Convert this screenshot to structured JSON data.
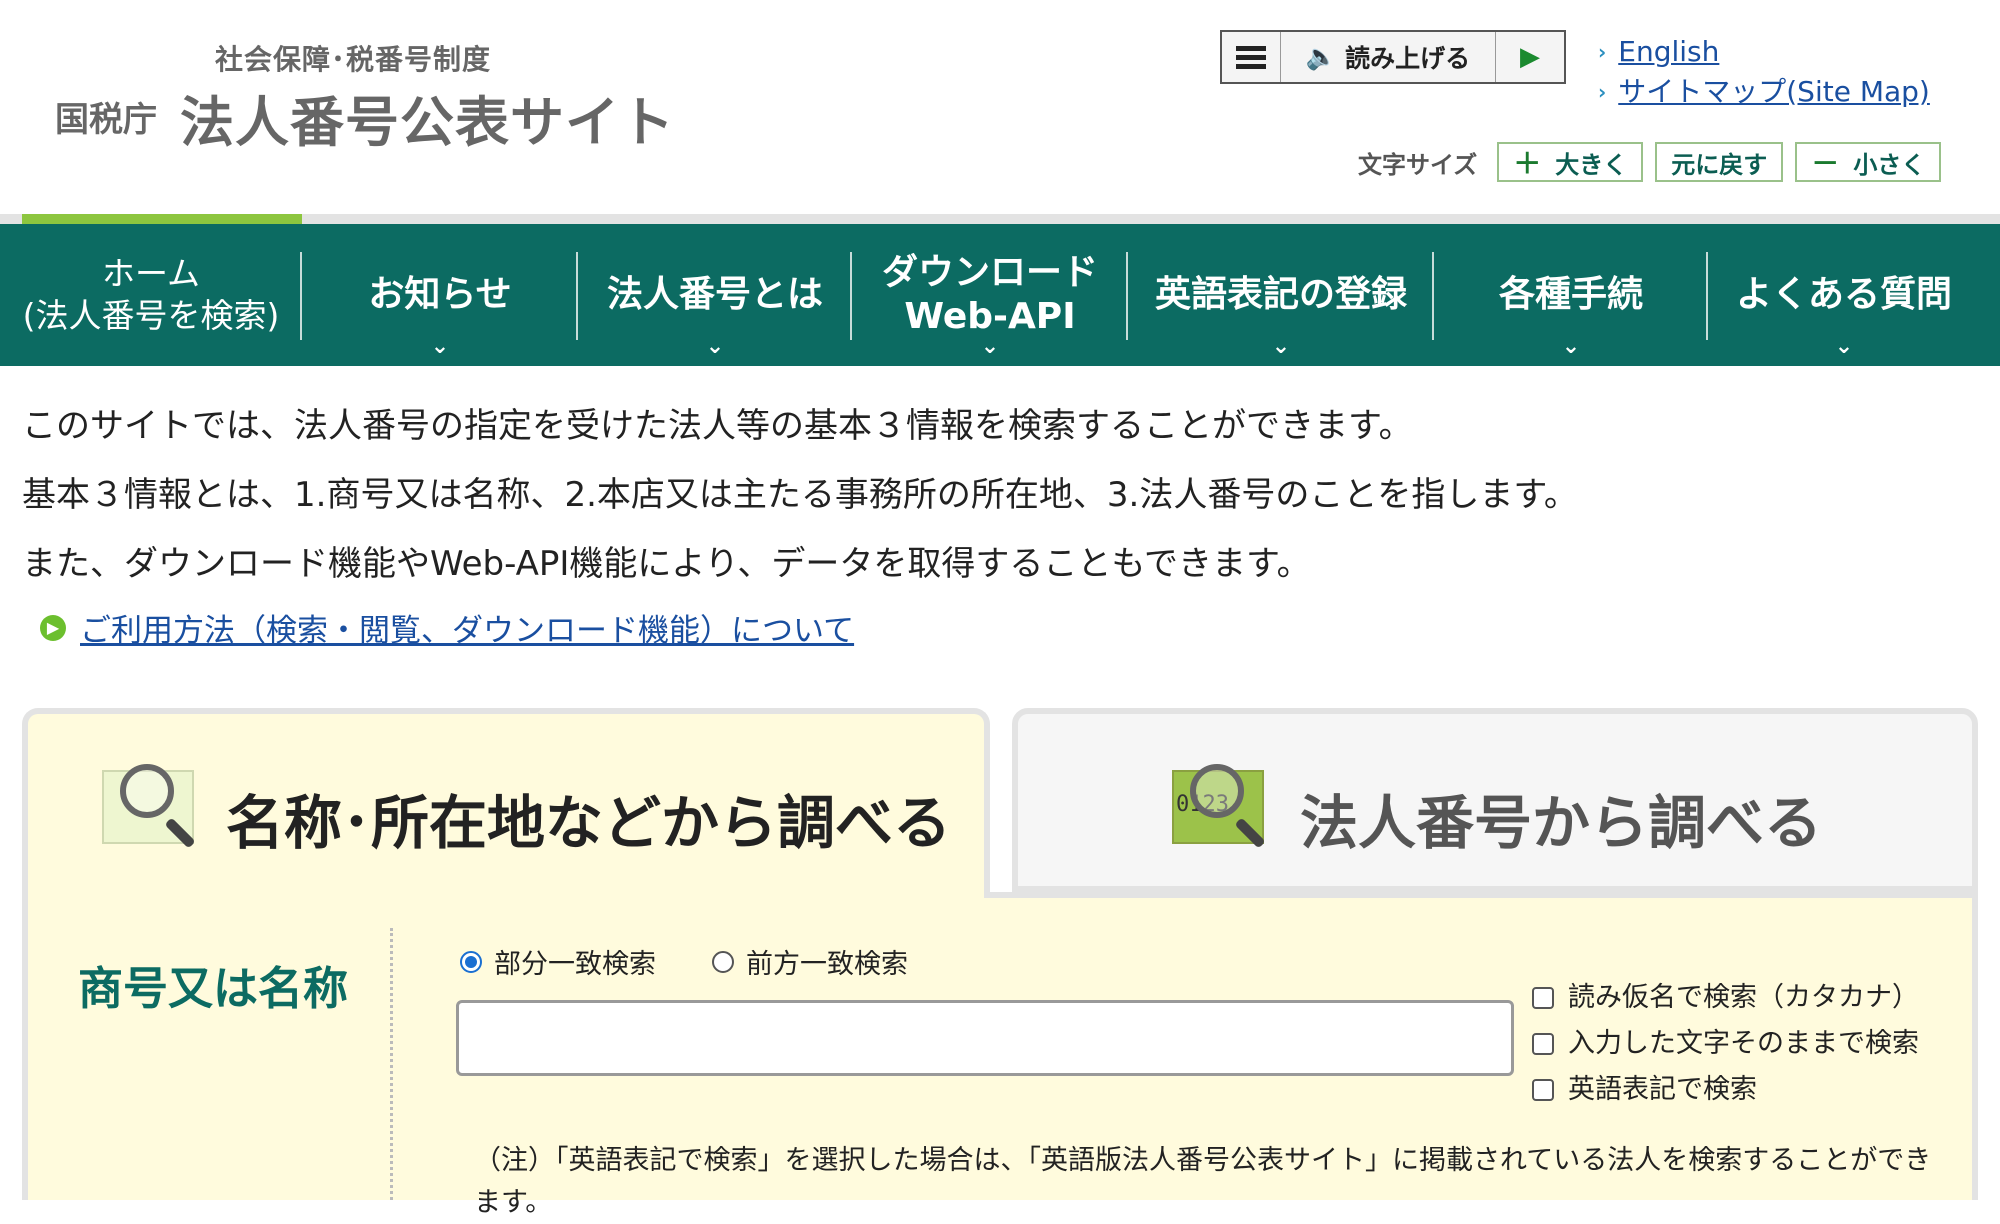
{
  "header": {
    "logo_subtitle": "社会保障･税番号制度",
    "logo_agency": "国税庁",
    "logo_title": "法人番号公表サイト",
    "reader_label": "読み上げる",
    "links": [
      {
        "label": "English"
      },
      {
        "label": "サイトマップ(Site Map)"
      }
    ],
    "font_size": {
      "label": "文字サイズ",
      "larger": "大きく",
      "reset": "元に戻す",
      "smaller": "小さく"
    }
  },
  "nav": {
    "home_line1": "ホーム",
    "home_line2": "(法人番号を検索)",
    "items": [
      {
        "label": "お知らせ"
      },
      {
        "label": "法人番号とは"
      },
      {
        "label_line1": "ダウンロード",
        "label_line2": "Web-API"
      },
      {
        "label": "英語表記の登録"
      },
      {
        "label": "各種手続"
      },
      {
        "label": "よくある質問"
      }
    ],
    "active_color": "#8dc63f",
    "bar_color": "#0c6b62"
  },
  "intro": {
    "lines": [
      "このサイトでは、法人番号の指定を受けた法人等の基本３情報を検索することができます。",
      "基本３情報とは、1.商号又は名称、2.本店又は主たる事務所の所在地、3.法人番号のことを指します。",
      "また、ダウンロード機能やWeb-API機能により、データを取得することもできます。"
    ],
    "guide_link": "ご利用方法（検索・閲覧、ダウンロード機能）について"
  },
  "search": {
    "tabs": [
      {
        "label": "名称･所在地などから調べる",
        "active": true,
        "icon": "building-magnifier-icon"
      },
      {
        "label": "法人番号から調べる",
        "active": false,
        "icon": "number-magnifier-icon",
        "icon_text": "0123"
      }
    ],
    "field_label": "商号又は名称",
    "radio_options": [
      {
        "label": "部分一致検索",
        "checked": true
      },
      {
        "label": "前方一致検索",
        "checked": false
      }
    ],
    "name_input": {
      "value": "",
      "placeholder": ""
    },
    "checkboxes": [
      {
        "label": "読み仮名で検索（カタカナ）",
        "checked": false
      },
      {
        "label": "入力した文字そのままで検索",
        "checked": false
      },
      {
        "label": "英語表記で検索",
        "checked": false
      }
    ],
    "note": "（注）「英語表記で検索」を選択した場合は、「英語版法人番号公表サイト」に掲載されている法人を検索することができます。"
  }
}
